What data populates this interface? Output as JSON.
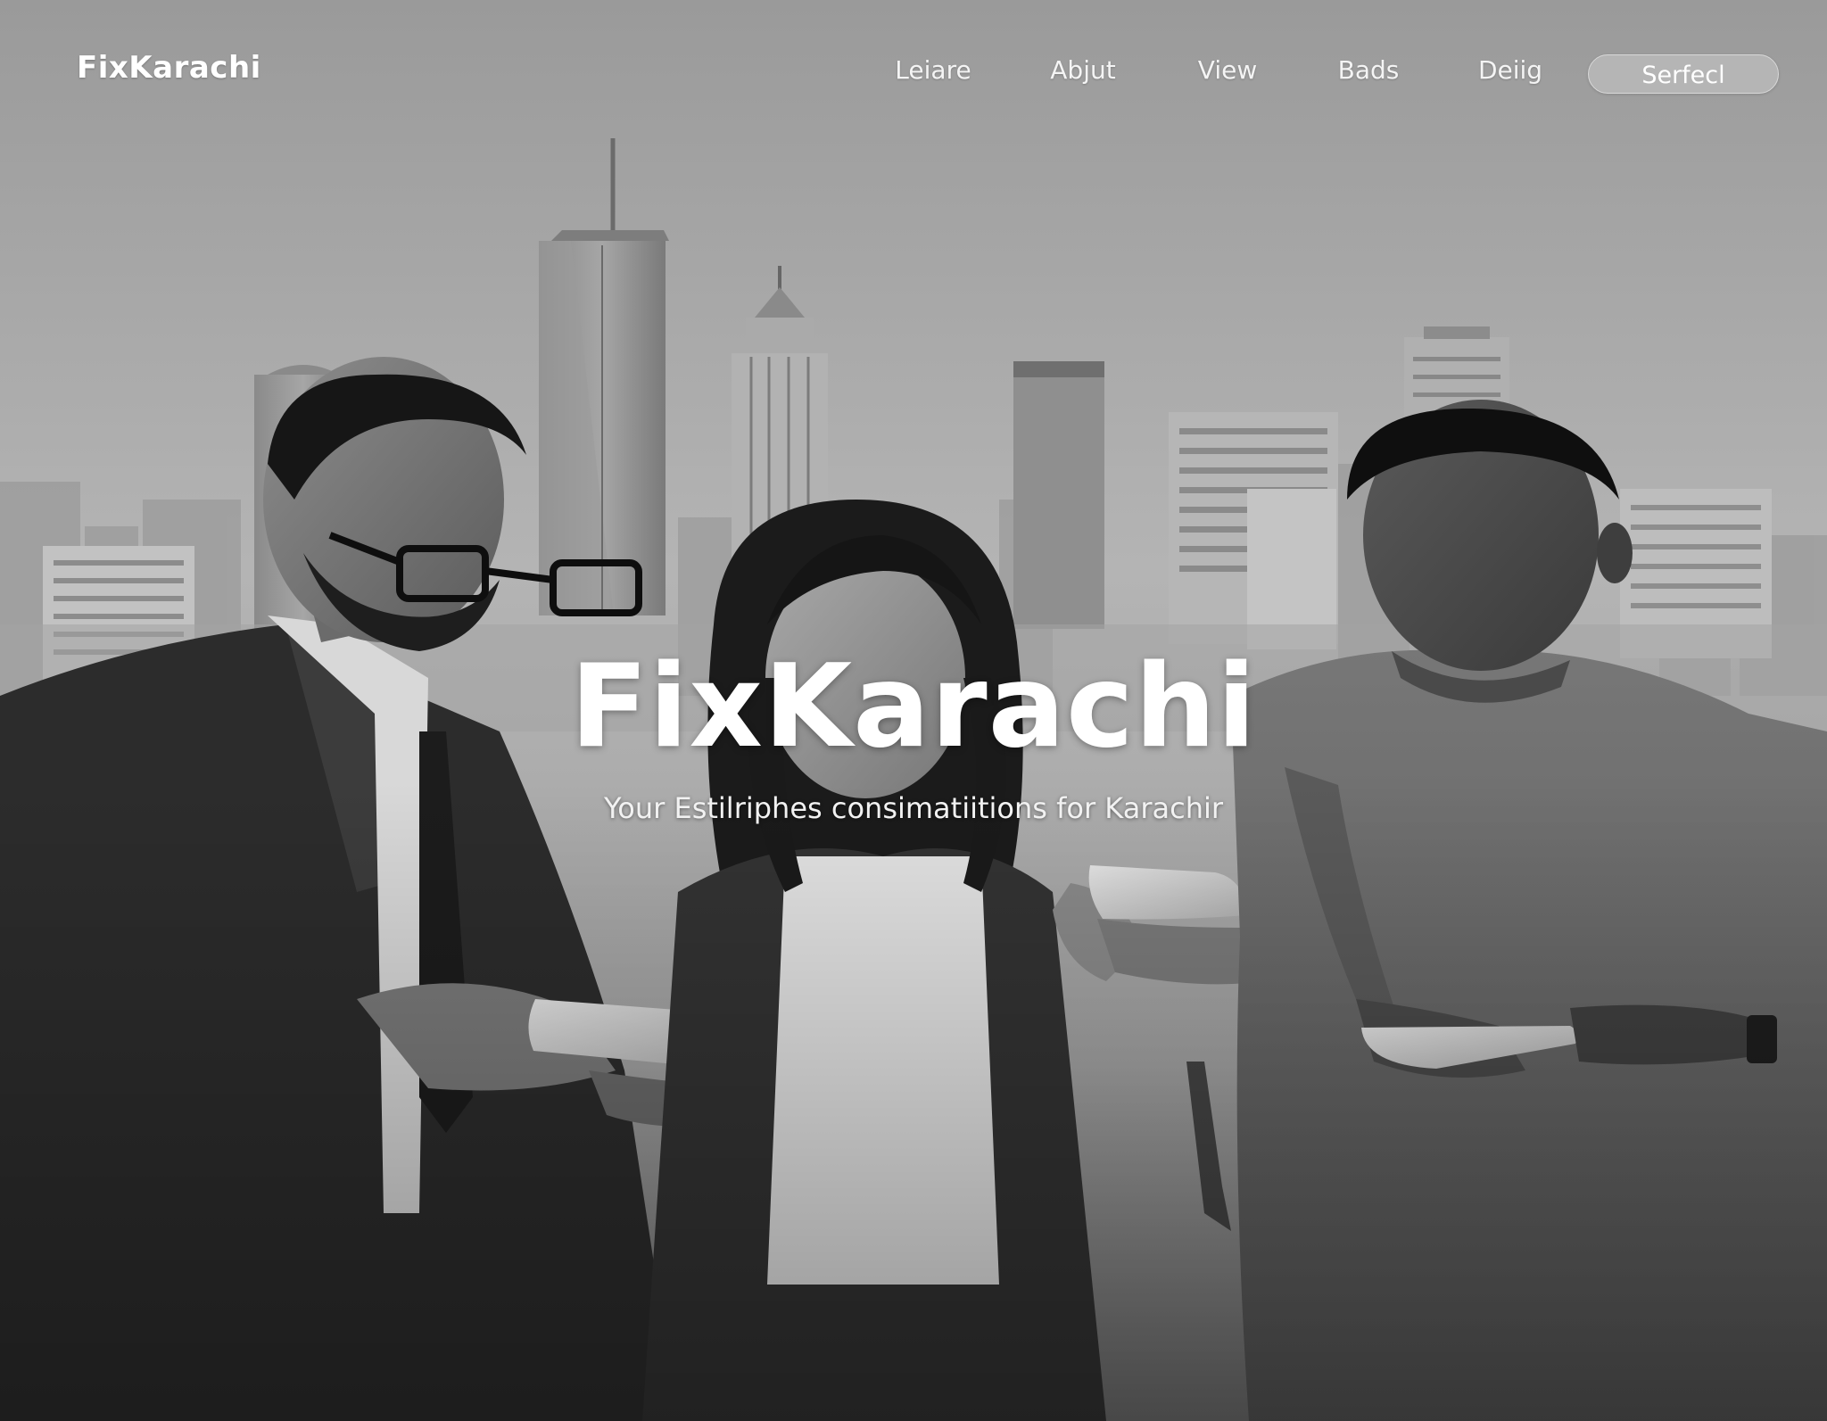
{
  "nav": {
    "brand": "FixKarachi",
    "links": [
      "Leiare",
      "Abjut",
      "View",
      "Bads",
      "Deiig"
    ],
    "cta": "Serfecl"
  },
  "hero": {
    "title": "FixKarachi",
    "subtitle": "Your Estilriphes consimatiitions for Karachir",
    "background": "grayscale photo of three people looking at smartphones in front of a city skyline"
  },
  "colors": {
    "text": "#ffffff",
    "cta_bg": "#b5b5b5",
    "sky": "#a8a8a8"
  },
  "icons": []
}
